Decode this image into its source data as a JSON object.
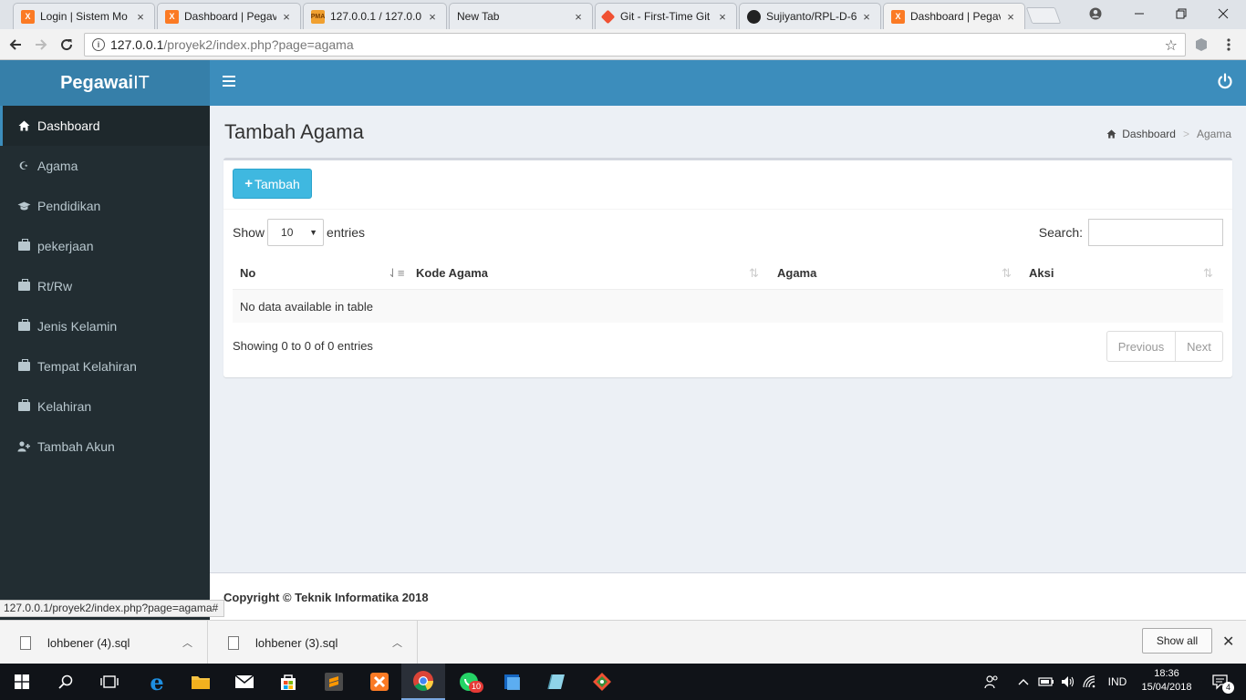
{
  "browser": {
    "tabs": [
      {
        "label": "Login | Sistem Mo",
        "favicon": "xampp-icon",
        "color": "#fb7a24"
      },
      {
        "label": "Dashboard | Pegav",
        "favicon": "xampp-icon",
        "color": "#fb7a24"
      },
      {
        "label": "127.0.0.1 / 127.0.0",
        "favicon": "phpmyadmin-icon",
        "color": "#f0a030"
      },
      {
        "label": "New Tab",
        "favicon": "",
        "color": ""
      },
      {
        "label": "Git - First-Time Git",
        "favicon": "git-icon",
        "color": "#f05133"
      },
      {
        "label": "Sujiyanto/RPL-D-6",
        "favicon": "github-icon",
        "color": "#222222"
      },
      {
        "label": "Dashboard | Pegav",
        "favicon": "xampp-icon",
        "color": "#fb7a24"
      }
    ],
    "close_glyph": "×",
    "url_host": "127.0.0.1",
    "url_path": "/proyek2/index.php?page=agama",
    "status_url": "127.0.0.1/proyek2/index.php?page=agama#"
  },
  "app": {
    "logo_bold": "Pegawai",
    "logo_light": "IT",
    "accent_color": "#3c8dbc",
    "sidebar_color": "#222d32",
    "sidebar": [
      {
        "label": "Dashboard",
        "icon": "home-icon",
        "active": true
      },
      {
        "label": "Agama",
        "icon": "moon-icon",
        "active": false
      },
      {
        "label": "Pendidikan",
        "icon": "graduation-cap-icon",
        "active": false
      },
      {
        "label": "pekerjaan",
        "icon": "briefcase-icon",
        "active": false
      },
      {
        "label": "Rt/Rw",
        "icon": "briefcase-icon",
        "active": false
      },
      {
        "label": "Jenis Kelamin",
        "icon": "briefcase-icon",
        "active": false
      },
      {
        "label": "Tempat Kelahiran",
        "icon": "briefcase-icon",
        "active": false
      },
      {
        "label": "Kelahiran",
        "icon": "briefcase-icon",
        "active": false
      },
      {
        "label": "Tambah Akun",
        "icon": "user-plus-icon",
        "active": false
      }
    ],
    "page_title": "Tambah Agama",
    "breadcrumb": {
      "home": "Dashboard",
      "current": "Agama",
      "separator": ">"
    },
    "add_button": "Tambah",
    "length": {
      "show": "Show",
      "value": "10",
      "entries": "entries"
    },
    "search_label": "Search:",
    "columns": [
      "No",
      "Kode Agama",
      "Agama",
      "Aksi"
    ],
    "empty_message": "No data available in table",
    "info": "Showing 0 to 0 of 0 entries",
    "pagination": {
      "previous": "Previous",
      "next": "Next"
    },
    "footer": "Copyright © Teknik Informatika 2018"
  },
  "downloads": {
    "items": [
      {
        "name": "lohbener (4).sql"
      },
      {
        "name": "lohbener (3).sql"
      }
    ],
    "show_all": "Show all"
  },
  "taskbar": {
    "language": "IND",
    "time": "18:36",
    "date": "15/04/2018",
    "notifications": "4",
    "whatsapp_badge": "10"
  }
}
